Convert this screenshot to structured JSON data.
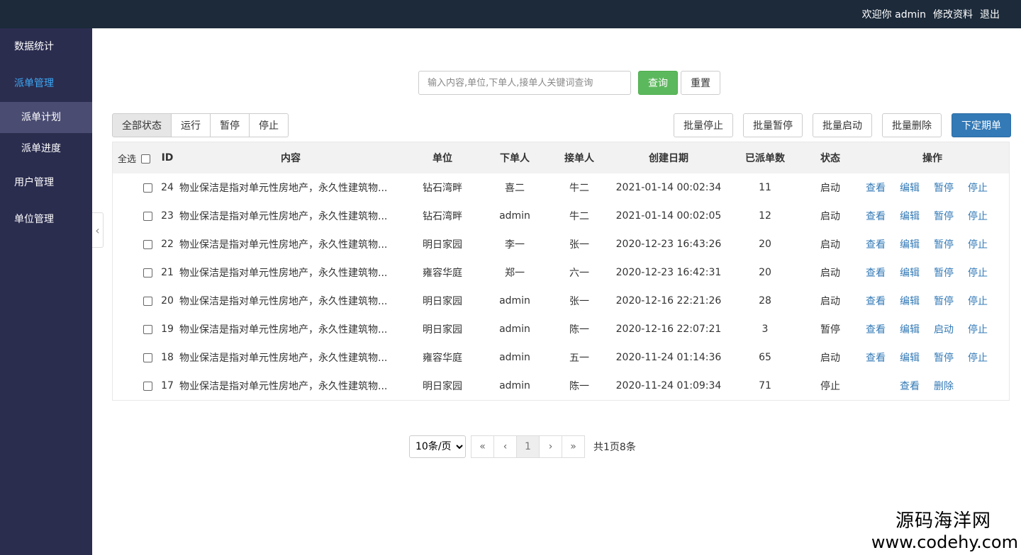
{
  "header": {
    "welcome": "欢迎你 admin",
    "edit_profile": "修改资料",
    "logout": "退出"
  },
  "sidebar": {
    "items": [
      {
        "label": "数据统计"
      },
      {
        "label": "派单管理"
      },
      {
        "label": "派单计划"
      },
      {
        "label": "派单进度"
      },
      {
        "label": "用户管理"
      },
      {
        "label": "单位管理"
      }
    ]
  },
  "search": {
    "placeholder": "输入内容,单位,下单人,接单人关键词查询",
    "query_label": "查询",
    "reset_label": "重置"
  },
  "filters": [
    "全部状态",
    "运行",
    "暂停",
    "停止"
  ],
  "batch": {
    "stop": "批量停止",
    "pause": "批量暂停",
    "start": "批量启动",
    "delete": "批量删除",
    "create": "下定期单"
  },
  "table": {
    "headers": {
      "select_all": "全选",
      "id": "ID",
      "content": "内容",
      "unit": "单位",
      "orderer": "下单人",
      "receiver": "接单人",
      "created": "创建日期",
      "dispatched": "已派单数",
      "status": "状态",
      "actions": "操作"
    },
    "rows": [
      {
        "id": "24",
        "content": "物业保洁是指对单元性房地产，永久性建筑物...",
        "unit": "钻石湾畔",
        "orderer": "喜二",
        "receiver": "牛二",
        "created": "2021-01-14 00:02:34",
        "dispatched": "11",
        "status": "启动",
        "actions": [
          "查看",
          "编辑",
          "暂停",
          "停止"
        ]
      },
      {
        "id": "23",
        "content": "物业保洁是指对单元性房地产，永久性建筑物...",
        "unit": "钻石湾畔",
        "orderer": "admin",
        "receiver": "牛二",
        "created": "2021-01-14 00:02:05",
        "dispatched": "12",
        "status": "启动",
        "actions": [
          "查看",
          "编辑",
          "暂停",
          "停止"
        ]
      },
      {
        "id": "22",
        "content": "物业保洁是指对单元性房地产，永久性建筑物...",
        "unit": "明日家园",
        "orderer": "李一",
        "receiver": "张一",
        "created": "2020-12-23 16:43:26",
        "dispatched": "20",
        "status": "启动",
        "actions": [
          "查看",
          "编辑",
          "暂停",
          "停止"
        ]
      },
      {
        "id": "21",
        "content": "物业保洁是指对单元性房地产，永久性建筑物...",
        "unit": "雍容华庭",
        "orderer": "郑一",
        "receiver": "六一",
        "created": "2020-12-23 16:42:31",
        "dispatched": "20",
        "status": "启动",
        "actions": [
          "查看",
          "编辑",
          "暂停",
          "停止"
        ]
      },
      {
        "id": "20",
        "content": "物业保洁是指对单元性房地产，永久性建筑物...",
        "unit": "明日家园",
        "orderer": "admin",
        "receiver": "张一",
        "created": "2020-12-16 22:21:26",
        "dispatched": "28",
        "status": "启动",
        "actions": [
          "查看",
          "编辑",
          "暂停",
          "停止"
        ]
      },
      {
        "id": "19",
        "content": "物业保洁是指对单元性房地产，永久性建筑物...",
        "unit": "明日家园",
        "orderer": "admin",
        "receiver": "陈一",
        "created": "2020-12-16 22:07:21",
        "dispatched": "3",
        "status": "暂停",
        "actions": [
          "查看",
          "编辑",
          "启动",
          "停止"
        ]
      },
      {
        "id": "18",
        "content": "物业保洁是指对单元性房地产，永久性建筑物...",
        "unit": "雍容华庭",
        "orderer": "admin",
        "receiver": "五一",
        "created": "2020-11-24 01:14:36",
        "dispatched": "65",
        "status": "启动",
        "actions": [
          "查看",
          "编辑",
          "暂停",
          "停止"
        ]
      },
      {
        "id": "17",
        "content": "物业保洁是指对单元性房地产，永久性建筑物...",
        "unit": "明日家园",
        "orderer": "admin",
        "receiver": "陈一",
        "created": "2020-11-24 01:09:34",
        "dispatched": "71",
        "status": "停止",
        "actions": [
          "查看",
          "删除"
        ]
      }
    ]
  },
  "pagination": {
    "page_size": "10条/页",
    "first": "«",
    "prev": "‹",
    "current": "1",
    "next": "›",
    "last": "»",
    "summary": "共1页8条"
  },
  "watermark": {
    "cn": "源码海洋网",
    "url": "www.codehy.com"
  },
  "colors": {
    "topbar": "#1c2a3a",
    "sidebar": "#2b2d4f",
    "sidebar_active_text": "#3da8f5",
    "link": "#337ab7",
    "success": "#5cb85c",
    "primary": "#337ab7"
  },
  "icons": {
    "collapse": "chevron-left-icon",
    "checkbox": "checkbox-icon"
  }
}
